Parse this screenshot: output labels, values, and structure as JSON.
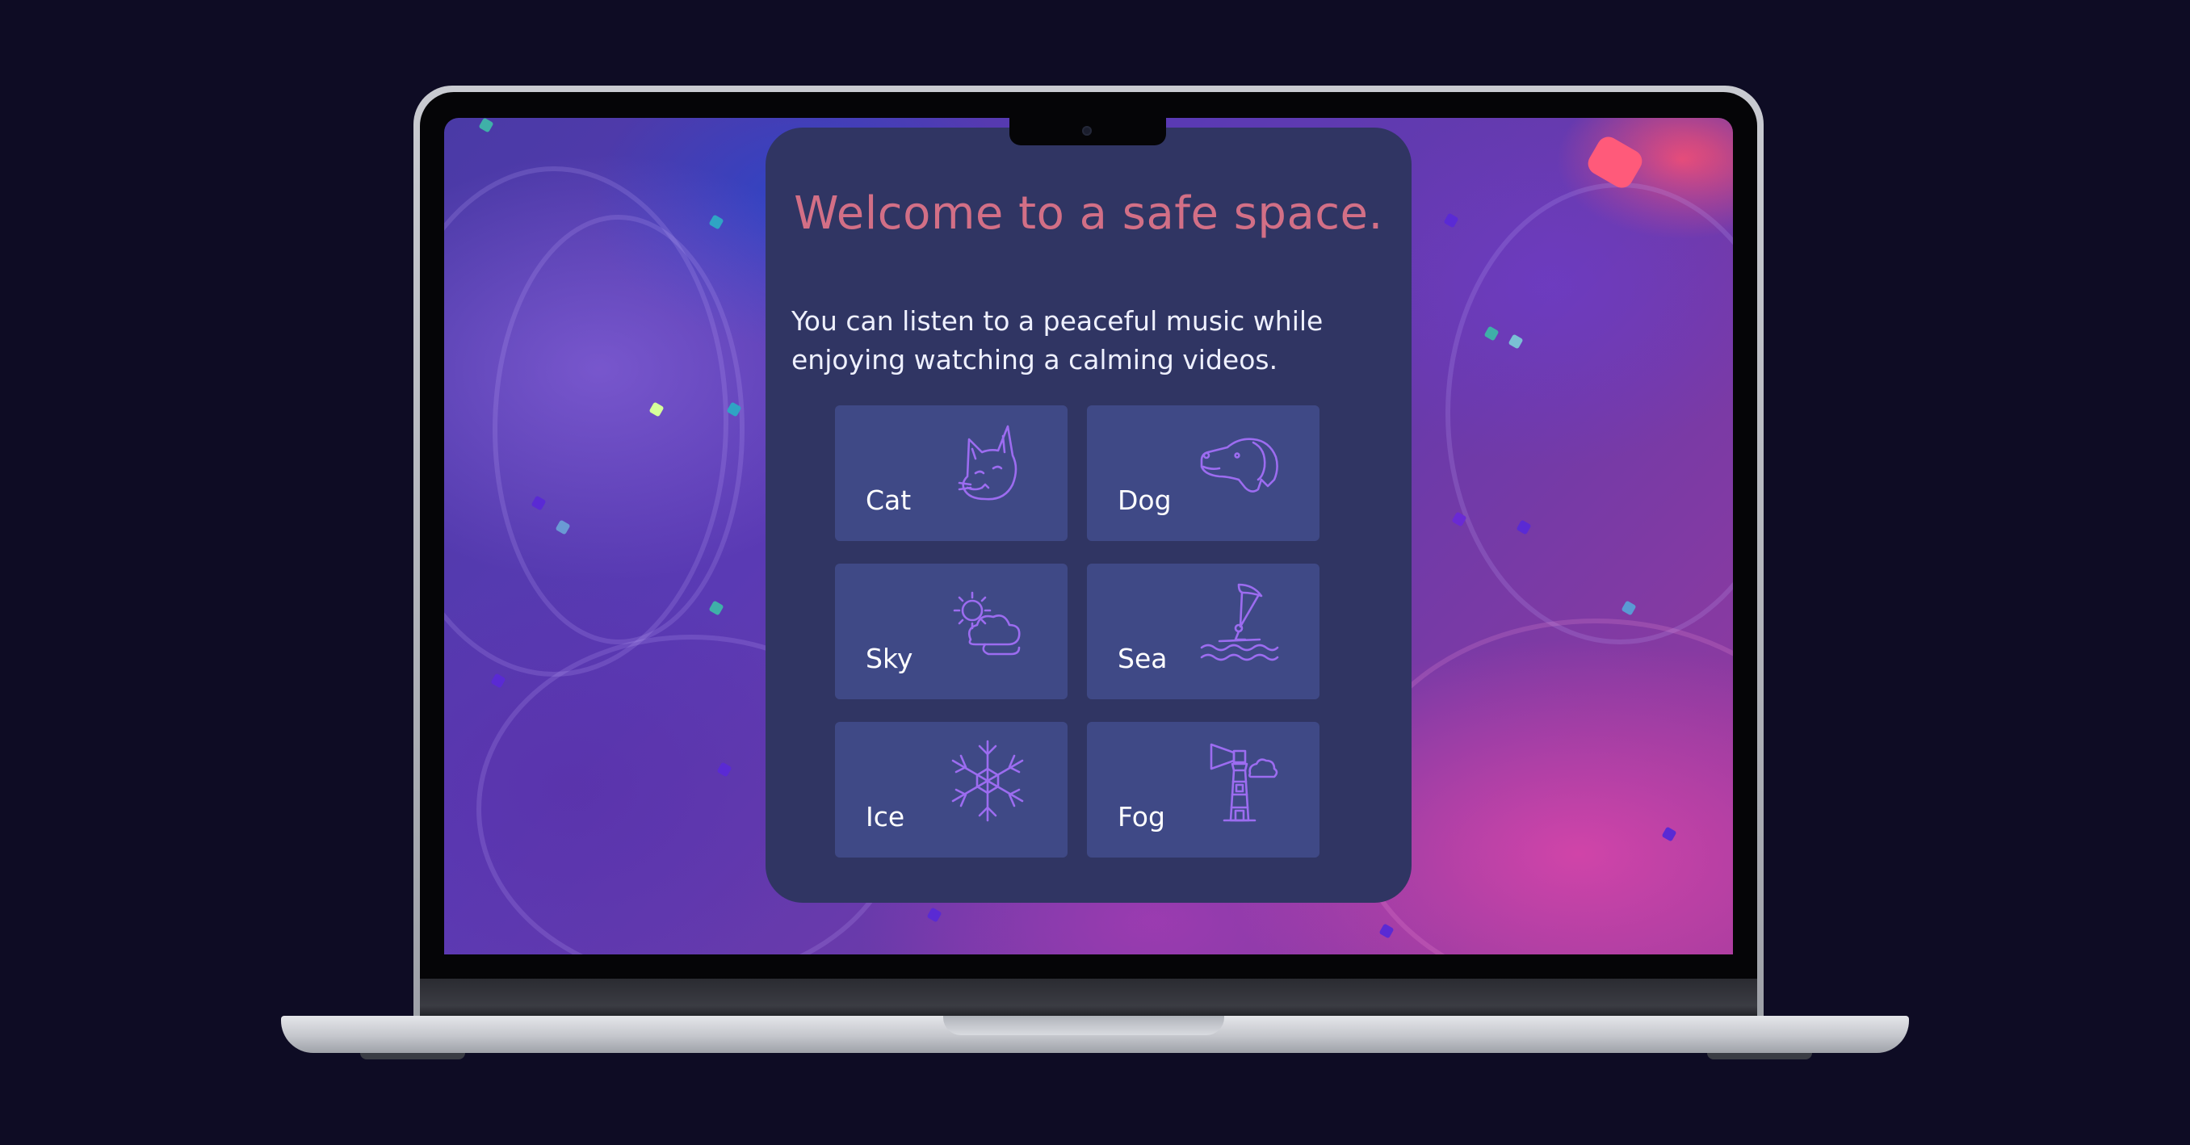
{
  "welcome": {
    "title": "Welcome to a safe space.",
    "subtitle_line1": "You can listen to a peaceful music while",
    "subtitle_line2": "enjoying watching a calming videos."
  },
  "tiles": [
    {
      "label": "Cat",
      "icon": "cat-icon"
    },
    {
      "label": "Dog",
      "icon": "dog-icon"
    },
    {
      "label": "Sky",
      "icon": "cloud-sun-icon"
    },
    {
      "label": "Sea",
      "icon": "kitesurf-icon"
    },
    {
      "label": "Ice",
      "icon": "snowflake-icon"
    },
    {
      "label": "Fog",
      "icon": "lighthouse-icon"
    }
  ],
  "colors": {
    "page_background": "#0e0c24",
    "card_background": "#303563",
    "tile_background": "#3f4986",
    "title_color": "#d26f86",
    "icon_stroke": "#9c6cf0",
    "text_color": "#ffffff"
  }
}
